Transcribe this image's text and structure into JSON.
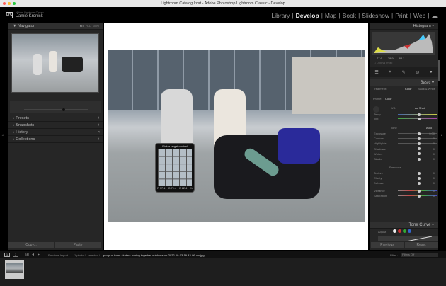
{
  "window": {
    "title": "Lightroom Catalog.lrcat - Adobe Photoshop Lightroom Classic - Develop"
  },
  "identity": {
    "app": "Adobe Lightroom Classic",
    "user": "Jamie Kronick",
    "logo": "LrC"
  },
  "modules": [
    "Library",
    "Develop",
    "Map",
    "Book",
    "Slideshow",
    "Print",
    "Web"
  ],
  "active_module": "Develop",
  "left_panel": {
    "navigator": {
      "title": "Navigator",
      "zoom_options": [
        "FIT",
        "FILL",
        "100%"
      ]
    },
    "sections": [
      "Presets",
      "Snapshots",
      "History",
      "Collections"
    ],
    "copy": "Copy...",
    "paste": "Paste"
  },
  "right_panel": {
    "histogram": {
      "title": "Histogram",
      "readout": [
        "77.6",
        "79.9",
        "83.1"
      ],
      "original_photo": "Original Photo"
    },
    "basic": {
      "title": "Basic",
      "treatment_label": "Treatment:",
      "color": "Color",
      "bw": "Black & White",
      "profile_label": "Profile:",
      "profile": "Color",
      "wb_label": "WB:",
      "wb": "As Shot",
      "temp": "Temp",
      "tint": "Tint",
      "tone": "Tone",
      "auto": "Auto",
      "tone_sliders": [
        {
          "label": "Exposure",
          "value": "0.00",
          "pos": 0.5
        },
        {
          "label": "Contrast",
          "value": "0",
          "pos": 0.5
        },
        {
          "label": "Highlights",
          "value": "0",
          "pos": 0.5
        },
        {
          "label": "Shadows",
          "value": "0",
          "pos": 0.5
        },
        {
          "label": "Whites",
          "value": "0",
          "pos": 0.5
        },
        {
          "label": "Blacks",
          "value": "0",
          "pos": 0.5
        }
      ],
      "presence": "Presence",
      "presence_sliders": [
        {
          "label": "Texture",
          "value": "0"
        },
        {
          "label": "Clarity",
          "value": "0"
        },
        {
          "label": "Dehaze",
          "value": "0"
        },
        {
          "label": "Vibrance",
          "value": "0"
        },
        {
          "label": "Saturation",
          "value": "0"
        }
      ]
    },
    "tone_curve": {
      "title": "Tone Curve",
      "adjust": "Adjust"
    },
    "previous": "Previous",
    "reset": "Reset"
  },
  "loupe": {
    "title": "Pick a target neutral",
    "r": "R 77.1",
    "g": "G 79.4",
    "b": "B 82.4",
    "pct": "%"
  },
  "filmstrip": {
    "source": "Previous Import",
    "info": "1 photo /1 selected /",
    "filename": "group-of-three-skaters-posing-together-outdoors-on-2022-10-03-19-43-09-utc.jpg",
    "filter_label": "Filter :",
    "filter": "Filters Off"
  },
  "colors": {
    "panel": "#262626",
    "accent": "#eeeeee"
  }
}
